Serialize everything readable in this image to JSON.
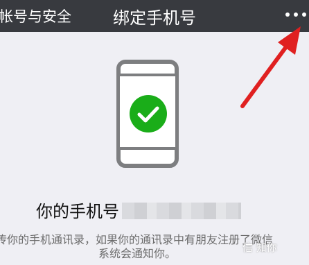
{
  "header": {
    "back_label": "帐号与安全",
    "title": "绑定手机号",
    "more_label": "•••"
  },
  "main": {
    "phone_label": "你的手机号",
    "description_line1": "传你的手机通讯录，如果你的通讯录中有朋友注册了微信",
    "description_line2": "系统会通知你。"
  },
  "watermark": "信 知你",
  "colors": {
    "topbar": "#383a3f",
    "background": "#efeff4",
    "check_green": "#1aad19",
    "arrow_red": "#e02020"
  },
  "icons": {
    "phone": "smartphone-icon",
    "check": "check-circle-icon",
    "more": "more-dots-icon"
  }
}
